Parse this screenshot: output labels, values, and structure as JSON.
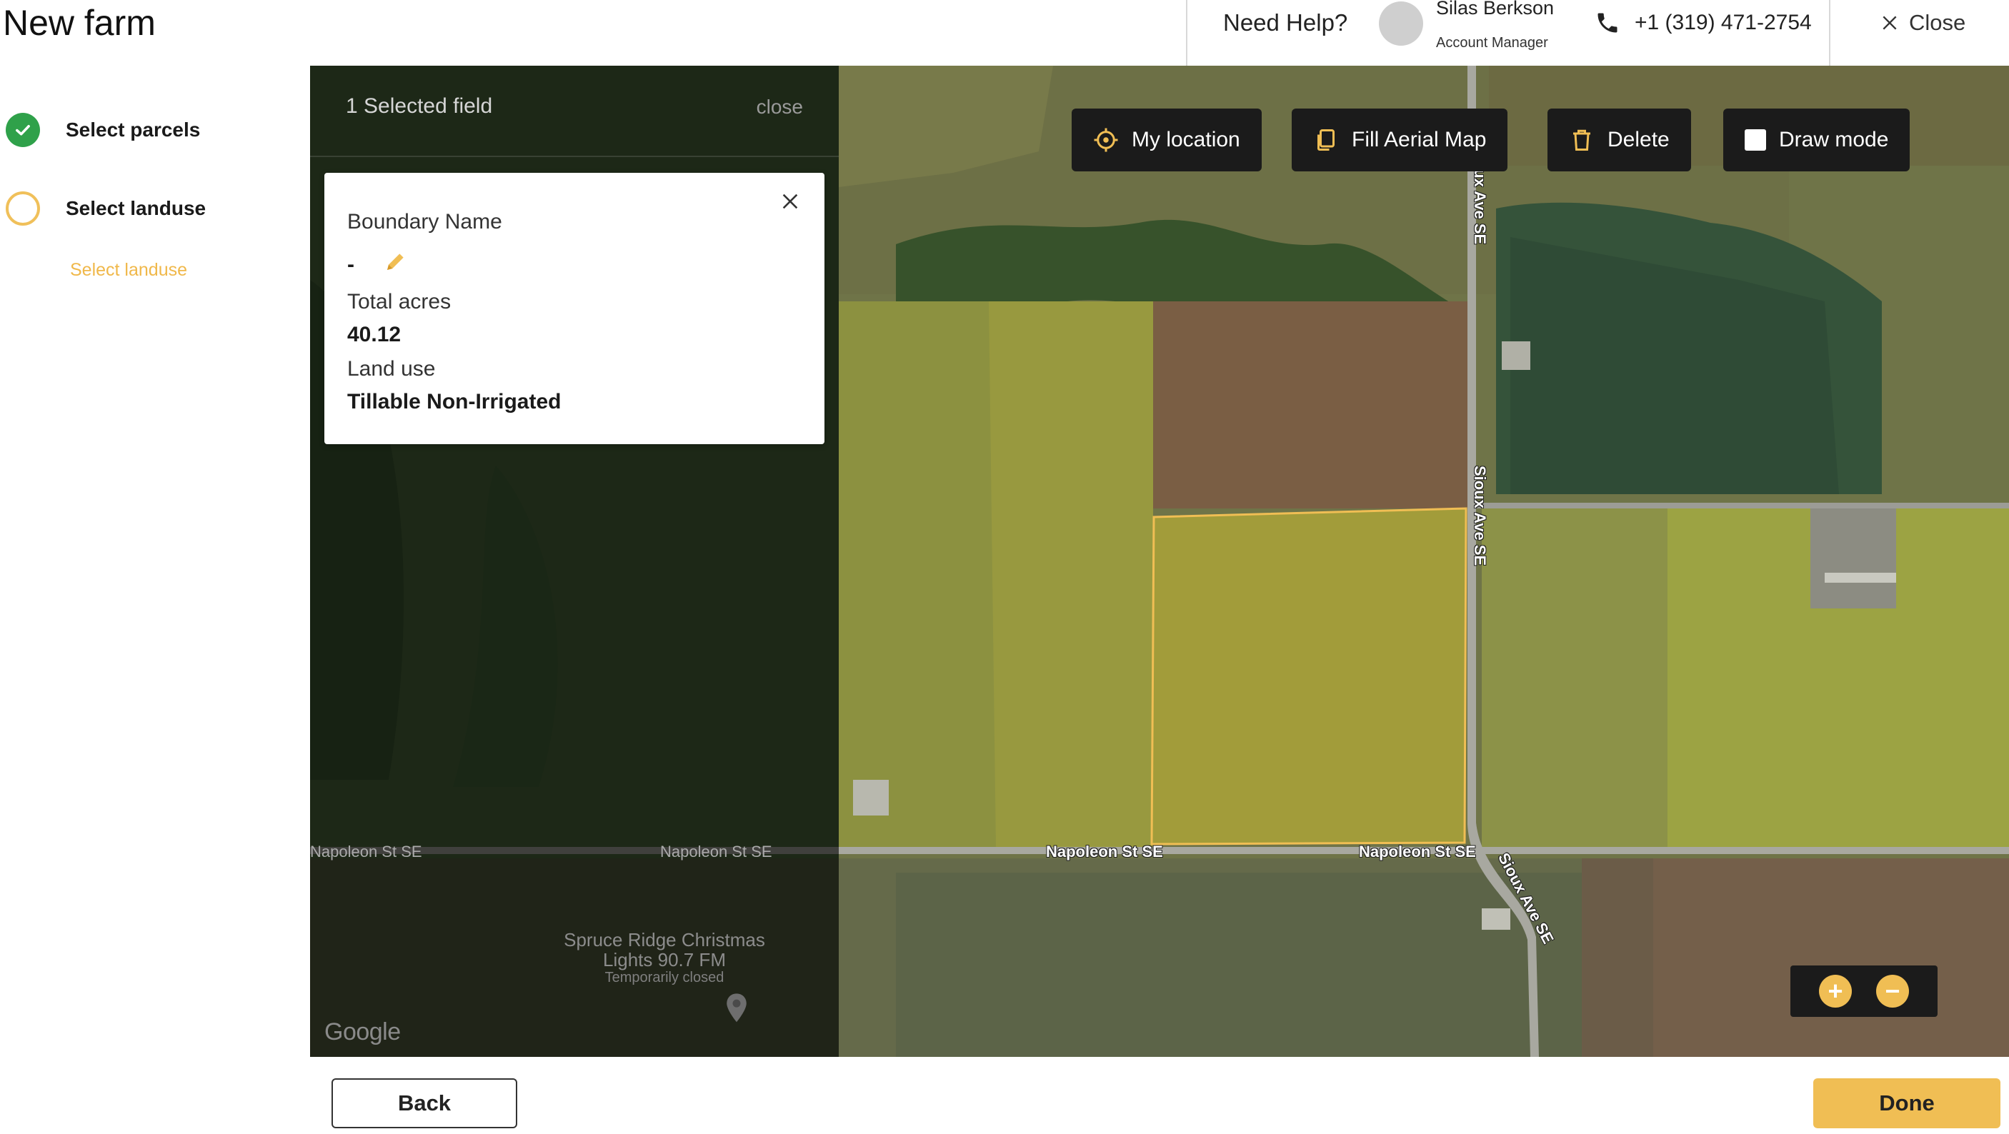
{
  "header": {
    "title": "New farm",
    "help_label": "Need Help?",
    "manager_name": "Silas Berkson",
    "manager_role": "Account Manager",
    "phone": "+1 (319) 471-2754",
    "close_label": "Close"
  },
  "steps": {
    "items": [
      {
        "label": "Select parcels",
        "status": "done"
      },
      {
        "label": "Select landuse",
        "status": "current"
      }
    ],
    "sub_link": "Select landuse"
  },
  "selection": {
    "count_label": "1 Selected field",
    "close_label": "close"
  },
  "field_card": {
    "boundary_label": "Boundary Name",
    "boundary_value": "-",
    "acres_label": "Total acres",
    "acres_value": "40.12",
    "landuse_label": "Land use",
    "landuse_value": "Tillable Non-Irrigated"
  },
  "toolbar": {
    "my_location": "My location",
    "fill_aerial": "Fill Aerial Map",
    "delete": "Delete",
    "draw_mode": "Draw mode"
  },
  "map": {
    "roads": {
      "napoleon_1": "Napoleon St SE",
      "napoleon_2": "Napoleon St SE",
      "napoleon_3": "Napoleon St SE",
      "napoleon_4": "Napoleon St SE",
      "sioux_1": "Sioux Ave SE",
      "sioux_2": "Sioux Ave SE",
      "sioux_3": "Sioux Ave SE"
    },
    "poi_name": "Spruce Ridge Christmas Lights 90.7 FM",
    "poi_status": "Temporarily closed",
    "attribution": "Google",
    "zoom_in": "+",
    "zoom_out": "−"
  },
  "footer": {
    "back_label": "Back",
    "done_label": "Done"
  },
  "colors": {
    "accent": "#f0be54",
    "done_green": "#2fa14a",
    "toolbar_bg": "#1b1b1b"
  }
}
